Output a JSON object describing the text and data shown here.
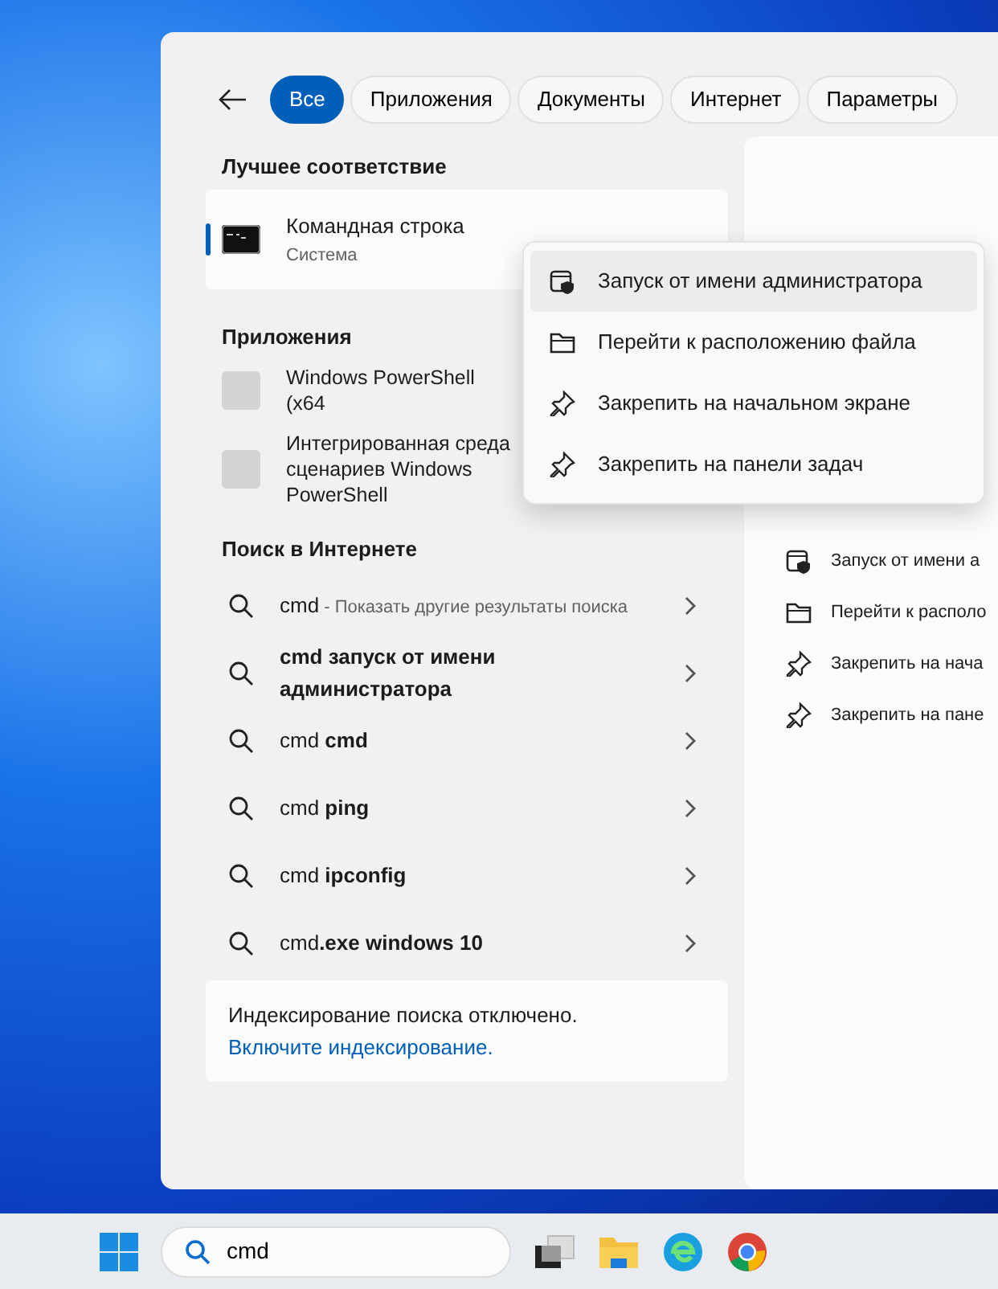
{
  "tabs": [
    {
      "label": "Все",
      "selected": true
    },
    {
      "label": "Приложения",
      "selected": false
    },
    {
      "label": "Документы",
      "selected": false
    },
    {
      "label": "Интернет",
      "selected": false
    },
    {
      "label": "Параметры",
      "selected": false
    }
  ],
  "best_match": {
    "heading": "Лучшее соответствие",
    "title": "Командная строка",
    "subtitle": "Система",
    "selected": true
  },
  "apps": {
    "heading": "Приложения",
    "items": [
      {
        "name": "Windows PowerShell (x64"
      },
      {
        "name": "Интегрированная среда сценариев Windows PowerShell"
      }
    ]
  },
  "web": {
    "heading": "Поиск в Интернете",
    "items": [
      {
        "text": "cmd",
        "note": "- Показать другие результаты поиска"
      },
      {
        "text": "**cmd запуск от имени администратора**"
      },
      {
        "text": "cmd **cmd**"
      },
      {
        "text": "cmd **ping**"
      },
      {
        "text": "cmd **ipconfig**"
      },
      {
        "text": "cmd**.exe windows 10**"
      }
    ]
  },
  "indexing": {
    "message": "Индексирование поиска отключено.",
    "link": "Включите индексирование."
  },
  "details_pane": {
    "actions": [
      {
        "kind": "admin",
        "label": "Запуск от имени а"
      },
      {
        "kind": "folder",
        "label": "Перейти к располо"
      },
      {
        "kind": "pin",
        "label": "Закрепить на нача"
      },
      {
        "kind": "pin",
        "label": "Закрепить на пане"
      }
    ]
  },
  "context_menu": [
    {
      "kind": "admin",
      "label": "Запуск от имени администратора",
      "highlighted": true
    },
    {
      "kind": "folder",
      "label": "Перейти к расположению файла",
      "highlighted": false
    },
    {
      "kind": "pin",
      "label": "Закрепить на начальном экране",
      "highlighted": false
    },
    {
      "kind": "pin",
      "label": "Закрепить на панели задач",
      "highlighted": false
    }
  ],
  "taskbar": {
    "search_value": "cmd"
  }
}
